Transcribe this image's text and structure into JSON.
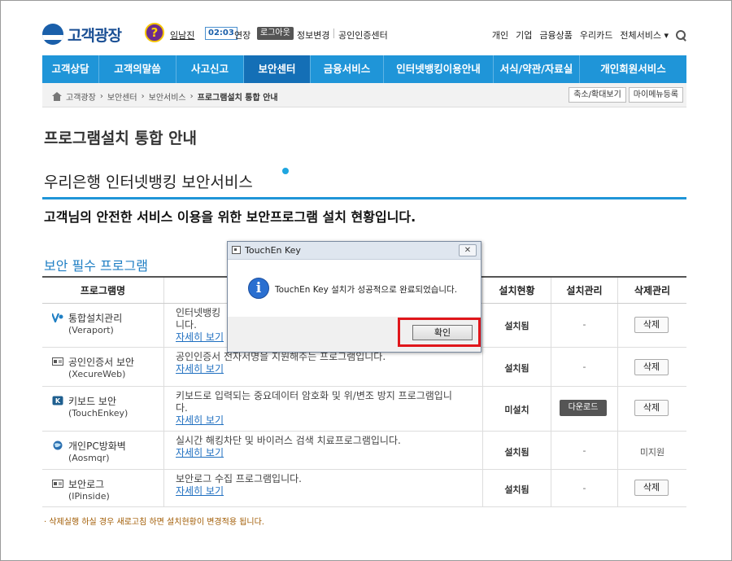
{
  "header": {
    "logo_text": "고객광장",
    "help_icon_glyph": "?",
    "username": "임남진",
    "timer": "02:03",
    "extend_label": "연장",
    "logout_label": "로그아웃",
    "info_change": "정보변경",
    "cert_center": "공인인증센터",
    "right_links": [
      "개인",
      "기업",
      "금융상품",
      "우리카드",
      "전체서비스 ▾"
    ]
  },
  "nav": {
    "items": [
      "고객상담",
      "고객의말씀",
      "사고신고",
      "보안센터",
      "금융서비스",
      "인터넷뱅킹이용안내",
      "서식/약관/자료실",
      "개인회원서비스"
    ],
    "active": "보안센터"
  },
  "breadcrumb": {
    "items": [
      "고객광장",
      "보안센터",
      "보안서비스",
      "프로그램설치 통합 안내"
    ],
    "buttons": [
      "축소/확대보기",
      "마이메뉴등록"
    ]
  },
  "page_title": "프로그램설치 통합 안내",
  "section": {
    "title": "우리은행 인터넷뱅킹 보안서비스",
    "description": "고객님의 안전한 서비스 이용을 위한 보안프로그램 설치 현황입니다.",
    "subtitle": "보안 필수 프로그램"
  },
  "table": {
    "headers": [
      "프로그램명",
      "",
      "설치현황",
      "설치관리",
      "삭제관리"
    ],
    "rows": [
      {
        "name": "통합설치관리",
        "en": "(Veraport)",
        "desc": "인터넷뱅킹",
        "desc2": "니다.",
        "more": "자세히 보기",
        "status": "설치됨",
        "manage": "-",
        "delete": "삭제"
      },
      {
        "name": "공인인증서 보안",
        "en": "(XecureWeb)",
        "desc": "공인인증서 전자서명을 지원해주는 프로그램입니다.",
        "desc2": "",
        "more": "자세히 보기",
        "status": "설치됨",
        "manage": "-",
        "delete": "삭제"
      },
      {
        "name": "키보드 보안",
        "en": "(TouchEnkey)",
        "desc": "키보드로 입력되는 중요데이터 암호화 및 위/변조 방지 프로그램입니",
        "desc2": "다.",
        "more": "자세히 보기",
        "status": "미설치",
        "manage": "다운로드",
        "delete": "삭제"
      },
      {
        "name": "개인PC방화벽",
        "en": "(Aosmqr)",
        "desc": "실시간 해킹차단 및 바이러스 검색 치료프로그램입니다.",
        "desc2": "",
        "more": "자세히 보기",
        "status": "설치됨",
        "manage": "-",
        "delete": "미지원"
      },
      {
        "name": "보안로그",
        "en": "(IPinside)",
        "desc": "보안로그 수집 프로그램입니다.",
        "desc2": "",
        "more": "자세히 보기",
        "status": "설치됨",
        "manage": "-",
        "delete": "삭제"
      }
    ]
  },
  "footnote": "· 삭제실행 하실 경우 새로고침 하면 설치현황이 변경적용 됩니다.",
  "dialog": {
    "title": "TouchEn Key",
    "message": "TouchEn Key 설치가 성공적으로 완료되었습니다.",
    "ok_label": "확인",
    "close_glyph": "✕",
    "info_glyph": "i"
  },
  "colors": {
    "nav_bg": "#1f95d8",
    "nav_active": "#146fb6",
    "highlight_outline": "#e0161b"
  }
}
